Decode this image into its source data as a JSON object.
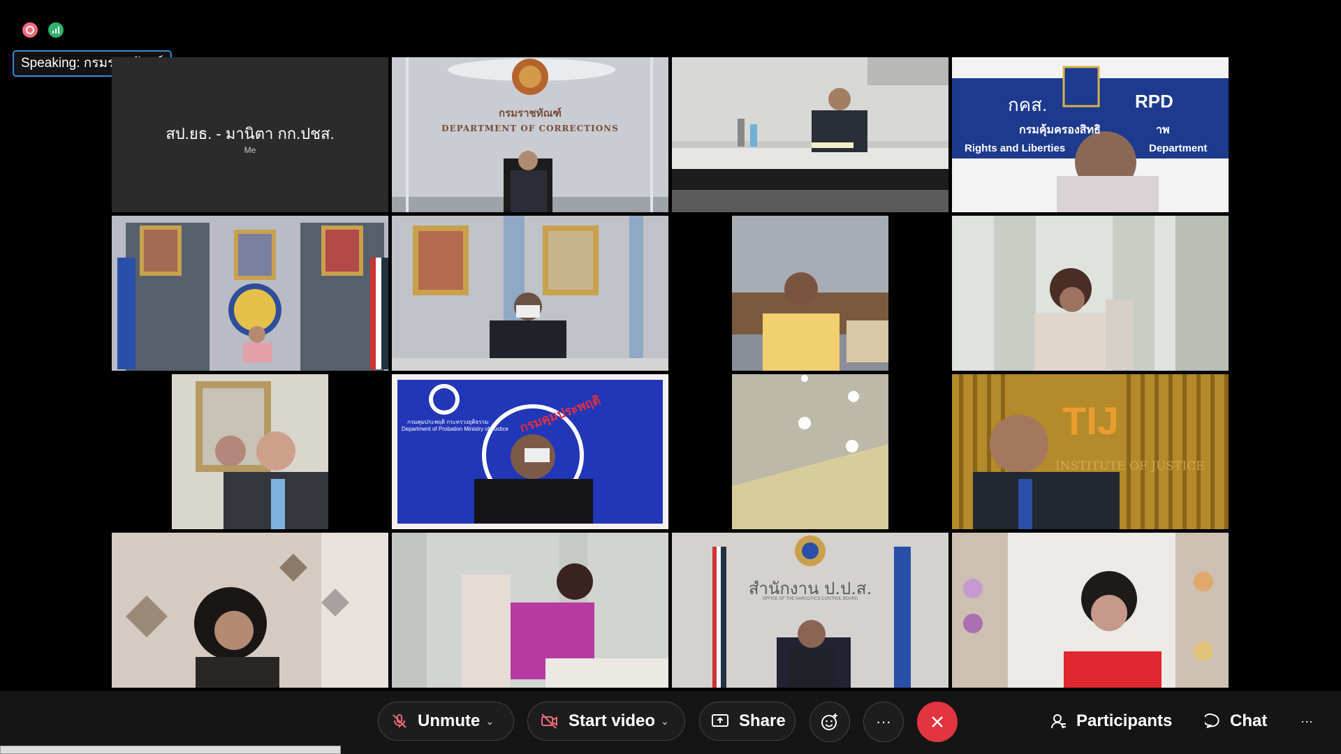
{
  "status_icons": {
    "recording": "record-icon",
    "network": "network-stats-icon"
  },
  "speaking": {
    "label": "Speaking: กรมราชทัณฑ์"
  },
  "tiles": [
    {
      "name": "สป.ยธ. - มานิตา กก.ปชส.",
      "sub": "Me"
    },
    {
      "sign_th": "กรมราชทัณฑ์",
      "sign_en": "DEPARTMENT OF CORRECTIONS"
    },
    {},
    {
      "sign_th": "กคส.",
      "sign_en": "RPD",
      "line2": "กรมคุ้มครองสิทธิ",
      "line2b": "าพ",
      "line3": "Rights and Liberties",
      "line3b": "Department"
    },
    {},
    {},
    {},
    {},
    {},
    {
      "sign_th": "กรมคุมประพฤติ",
      "small1": "กรมคุมประพฤติ  กระทรวงยุติธรรม",
      "small2": "Department of Probation Ministry of Justice"
    },
    {},
    {
      "sign_en": "TIJ",
      "small1": "INSTITUTE OF JUSTICE"
    },
    {},
    {},
    {
      "sign_th": "สำนักงาน ป.ป.ส.",
      "small1": "OFFICE OF THE NARCOTICS CONTROL BOARD"
    },
    {}
  ],
  "toolbar": {
    "unmute": "Unmute",
    "start_video": "Start video",
    "share": "Share",
    "participants": "Participants",
    "chat": "Chat",
    "more": "···",
    "reactions_icon": "emoji-icon",
    "leave_icon": "close-icon"
  },
  "colors": {
    "accent": "#2e8fd6",
    "leave": "#e3353f",
    "recording": "#f26b7a",
    "network": "#2fb36a"
  }
}
